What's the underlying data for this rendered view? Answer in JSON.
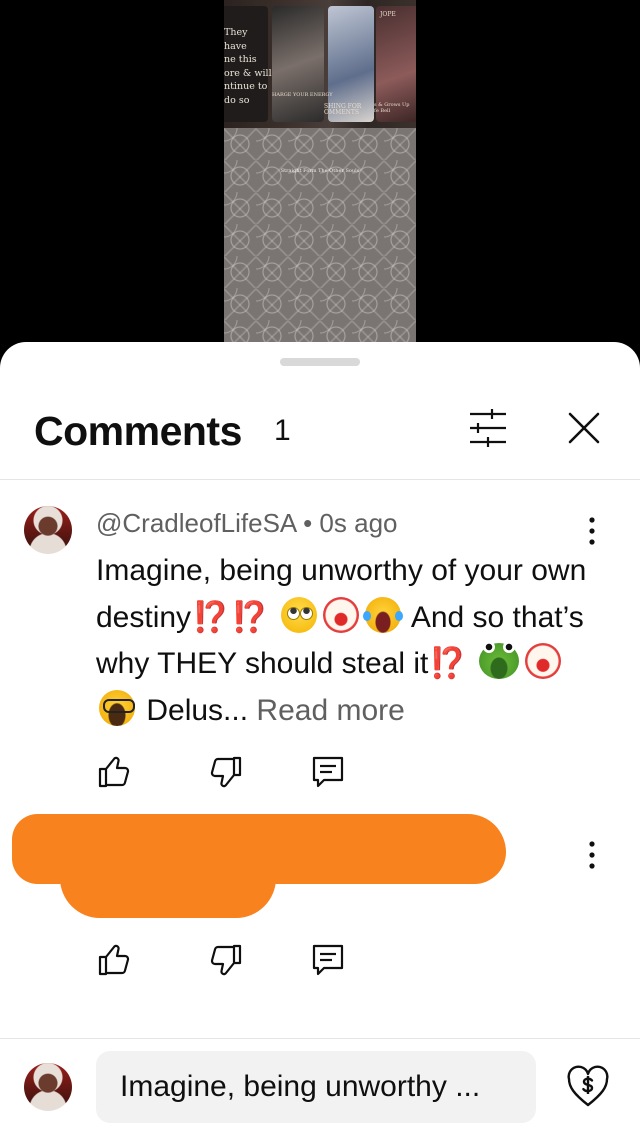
{
  "video": {
    "card_text": "They\nhave\nne this\nore & will\nntinue to\ndo so",
    "card_tiny_a": "HARGE YOUR ENERGY",
    "card_tiny_b": "SHING FOR\nOMMENTS",
    "card_tiny_c": "s & Grows Up\nfe Bell",
    "card_tiny_d": "JOPE",
    "pattern_label": "Straight Form The Other Souls"
  },
  "comments_panel": {
    "title": "Comments",
    "count": "1",
    "filter_icon": "sliders-icon",
    "close_icon": "close-icon"
  },
  "comments": [
    {
      "author": "@CradleofLifeSA",
      "separator": "•",
      "time": "0s ago",
      "text_1": "Imagine, being unworthy of your own destiny",
      "emoji_interrobang": "⁉️",
      "text_2": "And so that’s why THEY should steal it",
      "text_3": "Delus...",
      "read_more": "Read more"
    }
  ],
  "composer": {
    "input_value": "Imagine, being unworthy ...",
    "thanks_icon": "super-thanks-icon"
  },
  "colors": {
    "redaction": "#f7821e",
    "interrobang": "#e0242a",
    "secondary_text": "#606060"
  }
}
